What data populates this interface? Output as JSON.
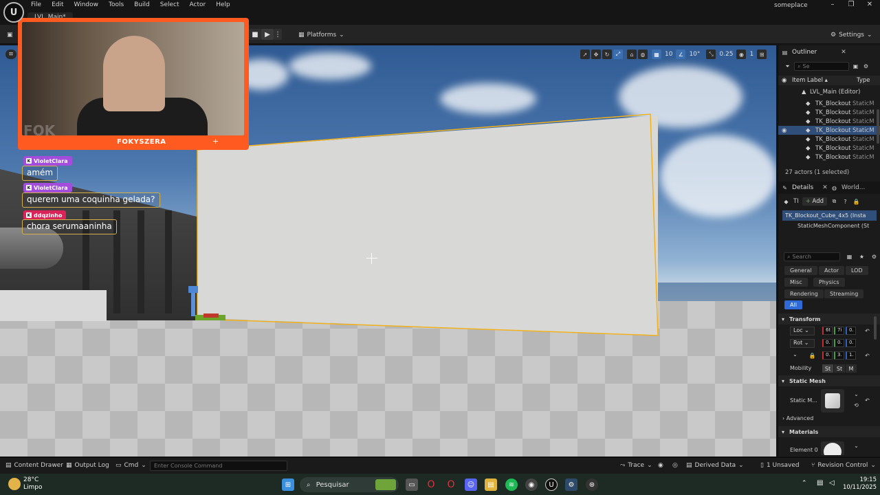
{
  "menu": {
    "items": [
      "File",
      "Edit",
      "Window",
      "Tools",
      "Build",
      "Select",
      "Actor",
      "Help"
    ],
    "project": "someplace"
  },
  "level_tab": "LVL_Main*",
  "toolbar": {
    "platforms": "Platforms",
    "settings": "Settings"
  },
  "viewport": {
    "grid_snap": "10",
    "rot_snap": "10°",
    "scale_snap": "0.25",
    "camera_speed": "1"
  },
  "webcam": {
    "name": "FOKYSZERA",
    "bg_text": "FOK"
  },
  "chat": [
    {
      "user": "VioletClara",
      "message": "amém",
      "user_color": "#a24ddb"
    },
    {
      "user": "VioletClara",
      "message": "querem uma coquinha gelada?",
      "user_color": "#a24ddb"
    },
    {
      "user": "ddqzinho",
      "message": "chora serumaaninha",
      "user_color": "#d9245a"
    }
  ],
  "outliner": {
    "title": "Outliner",
    "search_placeholder": "Se",
    "col_label": "Item Label ▴",
    "col_type": "Type",
    "root": "LVL_Main (Editor)",
    "rows": [
      {
        "label": "TK_Blockout",
        "type": "StaticM",
        "selected": false
      },
      {
        "label": "TK_Blockout",
        "type": "StaticM",
        "selected": false
      },
      {
        "label": "TK_Blockout",
        "type": "StaticM",
        "selected": false
      },
      {
        "label": "TK_Blockout",
        "type": "StaticM",
        "selected": true
      },
      {
        "label": "TK_Blockout",
        "type": "StaticM",
        "selected": false
      },
      {
        "label": "TK_Blockout",
        "type": "StaticM",
        "selected": false
      },
      {
        "label": "TK_Blockout",
        "type": "StaticM",
        "selected": false
      }
    ],
    "footer": "27 actors (1 selected)"
  },
  "details": {
    "tab_details": "Details",
    "tab_world": "World...",
    "actor_short": "TI",
    "add": "Add",
    "component_root": "TK_Blockout_Cube_4x5 (Insta",
    "component_child": "StaticMeshComponent (St",
    "search_placeholder": "Search",
    "categories": [
      "General",
      "Actor",
      "LOD",
      "Misc",
      "Physics",
      "Rendering",
      "Streaming",
      "All"
    ],
    "active_category": "All",
    "transform": {
      "title": "Transform",
      "location_label": "Loc",
      "rotation_label": "Rot",
      "location": [
        "6t",
        "7i",
        "0."
      ],
      "rotation": [
        "0.",
        "0.",
        "0."
      ],
      "scale": [
        "0.",
        "3.",
        "1."
      ],
      "mobility_label": "Mobility",
      "mobility_options": [
        "St",
        "St",
        "M"
      ]
    },
    "static_mesh": {
      "title": "Static Mesh",
      "label": "Static M..."
    },
    "advanced": "Advanced",
    "materials": {
      "title": "Materials",
      "element": "Element 0"
    }
  },
  "statusbar": {
    "content_drawer": "Content Drawer",
    "output_log": "Output Log",
    "cmd": "Cmd",
    "console_placeholder": "Enter Console Command",
    "trace": "Trace",
    "derived_data": "Derived Data",
    "unsaved": "1 Unsaved",
    "revision": "Revision Control"
  },
  "taskbar": {
    "temp": "28°C",
    "weather": "Limpo",
    "search": "Pesquisar",
    "time": "19:15",
    "date": "10/11/2025"
  }
}
